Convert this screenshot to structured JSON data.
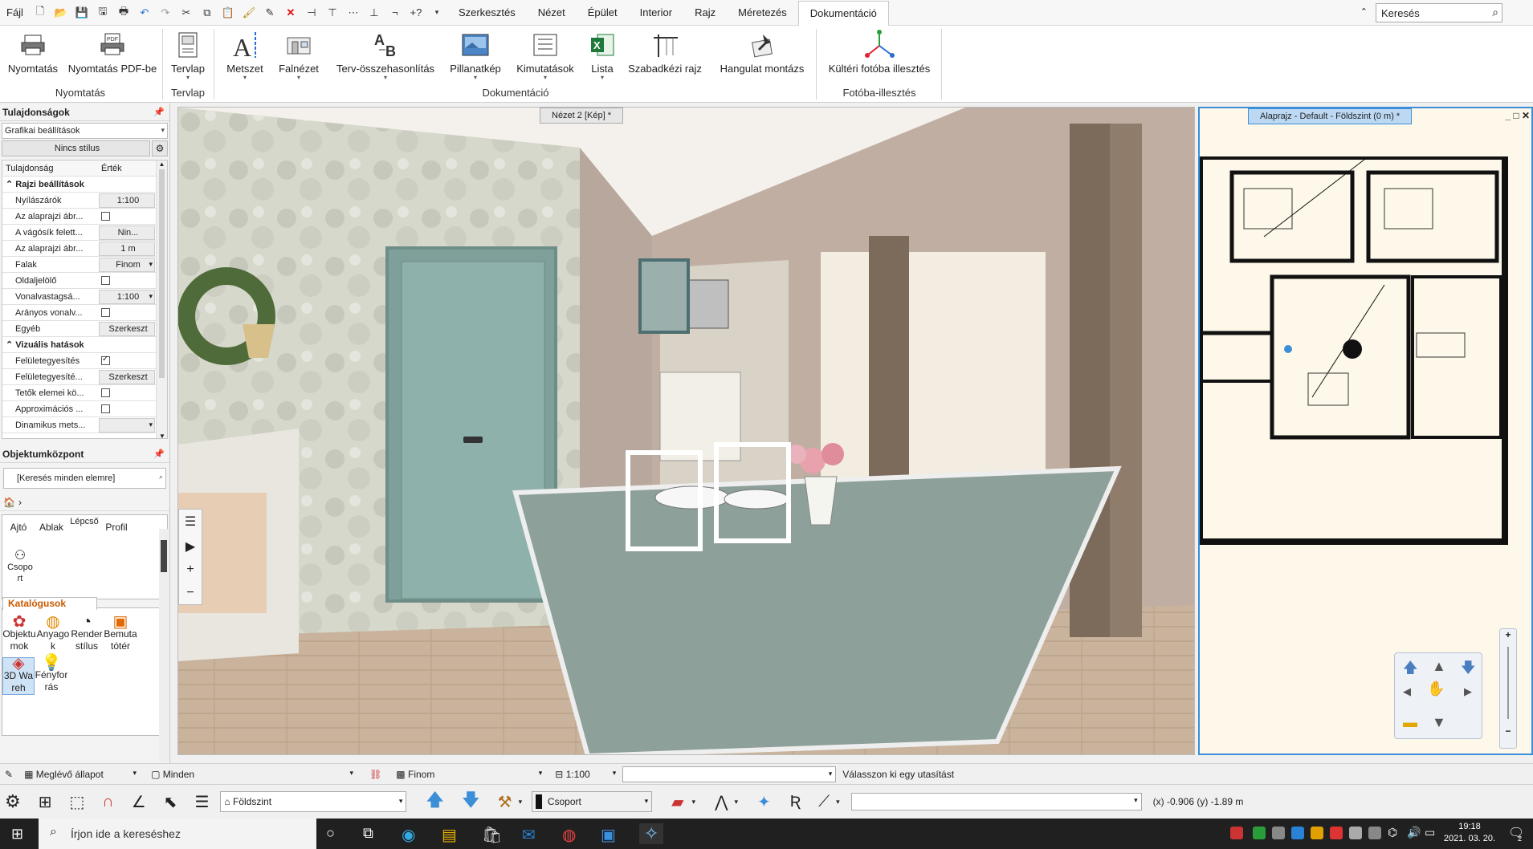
{
  "menu": {
    "file": "Fájl",
    "tabs": [
      "Szerkesztés",
      "Nézet",
      "Épület",
      "Interior",
      "Rajz",
      "Méretezés",
      "Dokumentáció"
    ],
    "active_tab": "Dokumentáció",
    "search_placeholder": "Keresés"
  },
  "ribbon": {
    "buttons": {
      "print": "Nyomtatás",
      "print_pdf": "Nyomtatás PDF-be",
      "plan_sheet": "Tervlap",
      "section": "Metszet",
      "wall_view": "Falnézet",
      "plan_compare": "Terv-összehasonlítás",
      "snapshot": "Pillanatkép",
      "reports": "Kimutatások",
      "list": "Lista",
      "freehand": "Szabadkézi rajz",
      "mood": "Hangulat montázs",
      "photo_insert": "Kültéri fotóba illesztés"
    },
    "groups": {
      "printing": "Nyomtatás",
      "sheet": "Tervlap",
      "documentation": "Dokumentáció",
      "photo": "Fotóba-illesztés"
    }
  },
  "properties": {
    "title": "Tulajdonságok",
    "filter": "Grafikai beállítások",
    "style": "Nincs stílus",
    "header_prop": "Tulajdonság",
    "header_val": "Érték",
    "rows": [
      {
        "k": "Rajzi beállítások",
        "section": true
      },
      {
        "k": "Nyílászárók",
        "v": "1:100"
      },
      {
        "k": "Az alaprajzi ábr...",
        "chk": false
      },
      {
        "k": "A vágósík felett...",
        "v": "Nin..."
      },
      {
        "k": "Az alaprajzi ábr...",
        "v": "1 m"
      },
      {
        "k": "Falak",
        "v": "Finom"
      },
      {
        "k": "Oldaljelölő",
        "chk": false
      },
      {
        "k": "Vonalvastagsá...",
        "v": "1:100"
      },
      {
        "k": "Arányos vonalv...",
        "chk": false
      },
      {
        "k": "Egyéb",
        "v": "Szerkeszt"
      },
      {
        "k": "Vizuális hatások",
        "section": true
      },
      {
        "k": "Felületegyesítés",
        "chk": true
      },
      {
        "k": "Felületegyesíté...",
        "v": "Szerkeszt"
      },
      {
        "k": "Tetők elemei kö...",
        "chk": false
      },
      {
        "k": "Approximációs ...",
        "chk": false
      },
      {
        "k": "Dinamikus mets...",
        "v": ""
      }
    ]
  },
  "objects": {
    "title": "Objektumközpont",
    "search": "[Keresés minden elemre]",
    "cats": [
      "Ajtó",
      "Ablak",
      "Lépcső",
      "Profil"
    ],
    "group": "Csoport",
    "catalogs_title": "Katalógusok",
    "catalogs": [
      "Objektumok",
      "Anyagok",
      "Render stílus",
      "Bemutatótér",
      "3D Wareh",
      "Fényforrás"
    ]
  },
  "views": {
    "view3d_tab": "Nézet 2 [Kép] *",
    "plan_tab": "Alaprajz - Default - Földszint (0 m) *"
  },
  "bottom": {
    "state": "Meglévő állapot",
    "all": "Minden",
    "fine": "Finom",
    "scale": "1:100",
    "prompt": "Válasszon ki egy utasítást",
    "level": "Földszint",
    "group": "Csoport",
    "coords": "(x) -0.906   (y) -1.89 m"
  },
  "taskbar": {
    "search": "Írjon ide a kereséshez",
    "time": "19:18",
    "date": "2021. 03. 20.",
    "notif": "2"
  },
  "colors": {
    "accent": "#3c8fd6",
    "catalog": "#c85a00"
  }
}
